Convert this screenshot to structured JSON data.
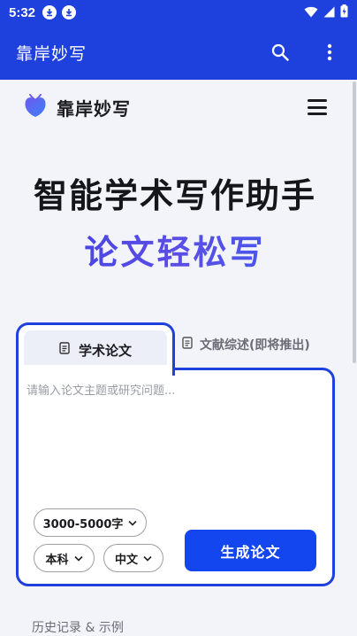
{
  "status_bar": {
    "time": "5:32"
  },
  "app_bar": {
    "title": "靠岸妙写"
  },
  "header": {
    "brand_name": "靠岸妙写"
  },
  "hero": {
    "title": "智能学术写作助手",
    "subtitle": "论文轻松写"
  },
  "tabs": [
    {
      "label": "学术论文",
      "active": true
    },
    {
      "label": "文献综述(即将推出)",
      "active": false
    }
  ],
  "input": {
    "placeholder": "请输入论文主题或研究问题...",
    "value": ""
  },
  "options": {
    "length": "3000-5000字",
    "degree": "本科",
    "language": "中文"
  },
  "generate_button": {
    "label": "生成论文"
  },
  "history": {
    "label": "历史记录 & 示例"
  },
  "colors": {
    "primary": "#1e40dc",
    "button": "#1446f0",
    "background": "#f3f4fa"
  }
}
